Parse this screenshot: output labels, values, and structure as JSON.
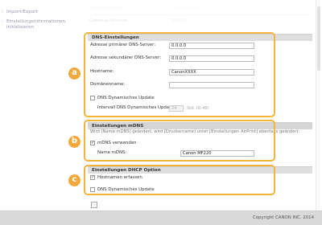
{
  "sidebar": {
    "items": [
      {
        "label": "Import/Export"
      },
      {
        "label": "Einstellungsinformationen initialisieren"
      }
    ]
  },
  "top_rows": [
    {
      "label": "Subnetzmaske:",
      "value": "255.255.255.0"
    },
    {
      "label": "Gateway-Adresse:",
      "value": "0.0.0.0"
    }
  ],
  "dns": {
    "title": "DNS-Einstellungen",
    "primary_label": "Adresse primärer DNS-Server:",
    "primary_value": "0.0.0.0",
    "secondary_label": "Adresse sekundärer DNS-Server:",
    "secondary_value": "0.0.0.0",
    "host_label": "Hostname:",
    "host_value": "CanonXXXX",
    "domain_label": "Domänenname:",
    "domain_value": "",
    "ddns_label": "DNS Dynamisches Update",
    "ddns_checked": false,
    "interval_label": "Intervall DNS Dynamisches Update:",
    "interval_value": "24",
    "interval_unit": "Std. (0-48)"
  },
  "mdns": {
    "title": "Einstellungen mDNS",
    "info": "Wird [Name mDNS] geändert, wird [Druckername] unter [Einstellungen AirPrint] ebenfalls geändert.",
    "use_label": "mDNS verwenden",
    "use_checked": true,
    "name_label": "Name mDNS:",
    "name_value": "Canon MF220"
  },
  "dhcp": {
    "title": "Einstellungen DHCP Option",
    "host_label": "Hostnamen erfassen",
    "host_checked": true,
    "ddns_label": "DNS Dynamisches Update",
    "ddns_checked": false
  },
  "callouts": {
    "a": "a",
    "b": "b",
    "c": "c"
  },
  "footer": {
    "copyright": "Copyright CANON INC. 2014"
  },
  "colors": {
    "accent": "#f2a93b",
    "section_header": "#dedede",
    "footer": "#dadada"
  }
}
